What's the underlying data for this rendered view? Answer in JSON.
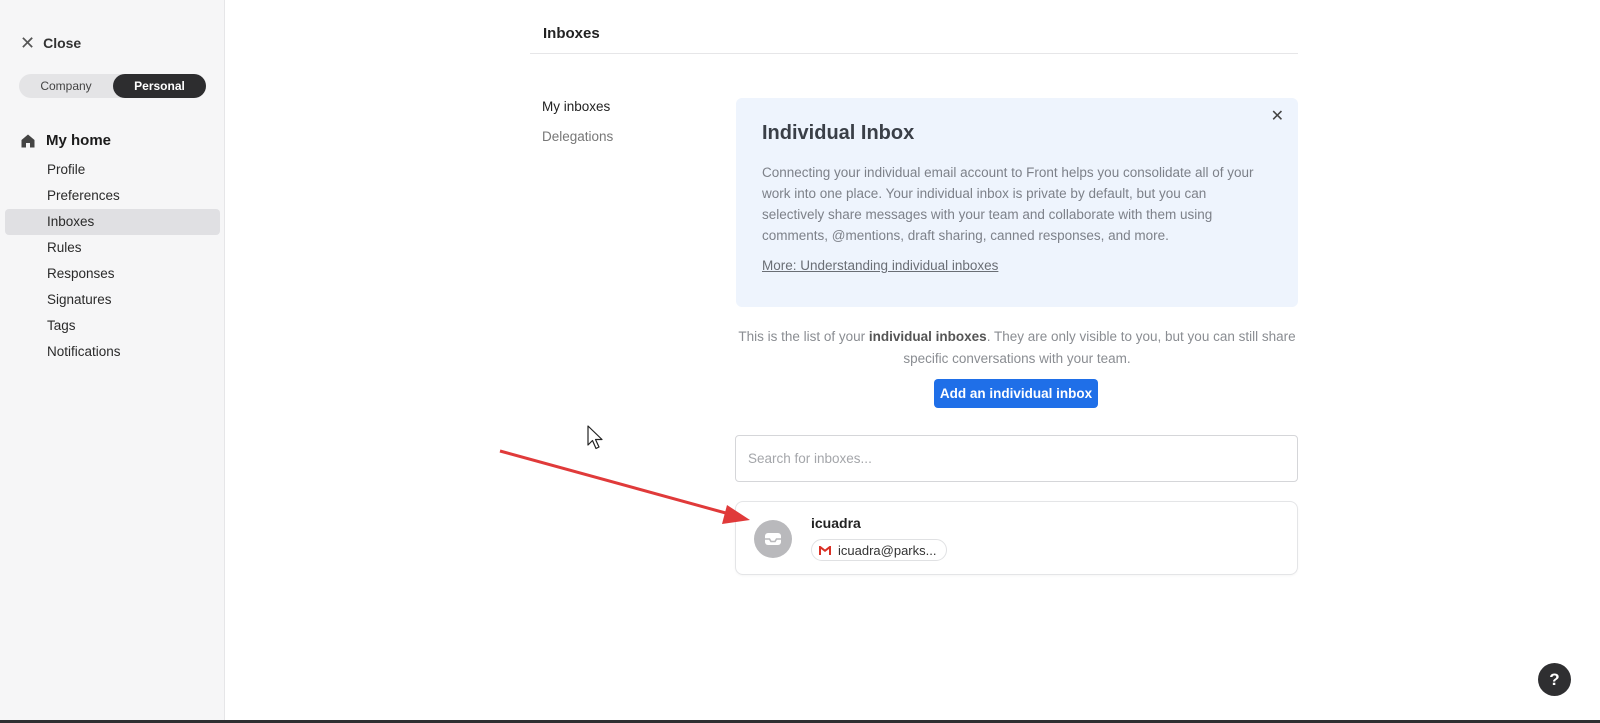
{
  "sidebar": {
    "close_label": "Close",
    "scope": {
      "company": "Company",
      "personal": "Personal",
      "selected": "Personal"
    },
    "home_label": "My home",
    "items": [
      {
        "label": "Profile"
      },
      {
        "label": "Preferences"
      },
      {
        "label": "Inboxes",
        "active": true
      },
      {
        "label": "Rules"
      },
      {
        "label": "Responses"
      },
      {
        "label": "Signatures"
      },
      {
        "label": "Tags"
      },
      {
        "label": "Notifications"
      }
    ]
  },
  "header": {
    "title": "Inboxes"
  },
  "subnav": {
    "my_inboxes": "My inboxes",
    "delegations": "Delegations"
  },
  "info_box": {
    "title": "Individual Inbox",
    "description": "Connecting your individual email account to Front helps you consolidate all of your work into one place. Your individual inbox is private by default, but you can selectively share messages with your team and collaborate with them using comments, @mentions, draft sharing, canned responses, and more.",
    "link": "More: Understanding individual inboxes"
  },
  "list_note": {
    "prefix": "This is the list of your ",
    "bold": "individual inboxes",
    "suffix": ". They are only visible to you, but you can still share specific conversations with your team."
  },
  "add_button": "Add an individual inbox",
  "search": {
    "placeholder": "Search for inboxes...",
    "value": ""
  },
  "inboxes": [
    {
      "name": "icuadra",
      "address": "icuadra@parks..."
    }
  ],
  "help_label": "?",
  "colors": {
    "accent": "#1f6fe8",
    "info_bg": "#eef4fd",
    "annotation_arrow": "#e03a3a"
  }
}
